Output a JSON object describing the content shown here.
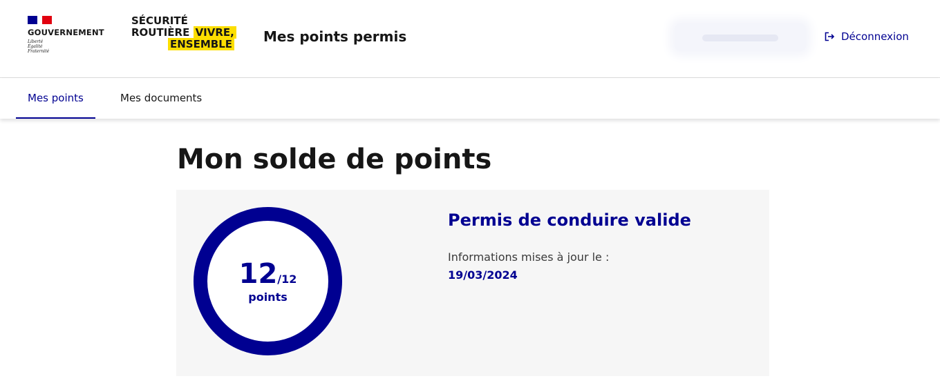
{
  "header": {
    "gov_name": "GOUVERNEMENT",
    "motto": [
      "Liberté",
      "Égalité",
      "Fraternité"
    ],
    "sr_logo": {
      "line1": "SÉCURITÉ",
      "line2": "ROUTIÈRE",
      "line2_highlight": "VIVRE,",
      "line3": "ENSEMBLE"
    },
    "site_title": "Mes points permis",
    "logout_label": "Déconnexion",
    "logout_icon": "logout-icon"
  },
  "nav": {
    "tabs": [
      {
        "label": "Mes points",
        "active": true
      },
      {
        "label": "Mes documents",
        "active": false
      }
    ]
  },
  "main": {
    "title": "Mon solde de points",
    "points": {
      "current": "12",
      "max": "/12",
      "unit": "points",
      "fraction": 1.0
    },
    "status": "Permis de conduire valide",
    "info_label": "Informations mises à jour le :",
    "info_date": "19/03/2024"
  },
  "colors": {
    "accent": "#000091",
    "flag_red": "#e1000f",
    "highlight": "#fcde00",
    "card_bg": "#f6f6f6"
  }
}
